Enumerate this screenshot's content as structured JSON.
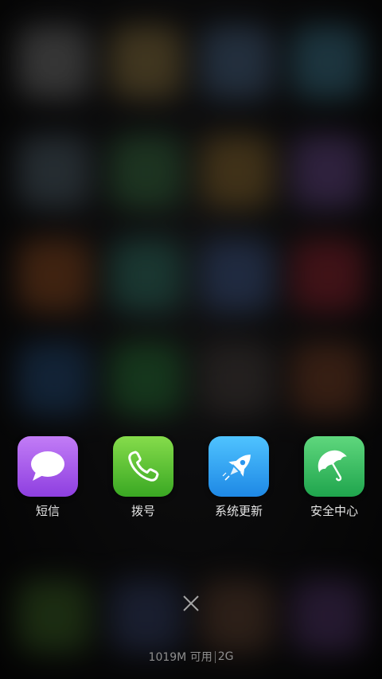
{
  "recent_apps": [
    {
      "label": "短信",
      "icon": "message-bubble-icon",
      "color": "#9a4fe6"
    },
    {
      "label": "拨号",
      "icon": "phone-handset-icon",
      "color": "#4cb830"
    },
    {
      "label": "系统更新",
      "icon": "rocket-icon",
      "color": "#2a95ee"
    },
    {
      "label": "安全中心",
      "icon": "umbrella-icon",
      "color": "#2db65a"
    }
  ],
  "close_button": {
    "icon": "close-icon"
  },
  "memory": {
    "available": "1019M 可用",
    "network": "2G"
  },
  "colors": {
    "label_text": "#e6e6e6",
    "status_text": "#8e8e8e"
  }
}
